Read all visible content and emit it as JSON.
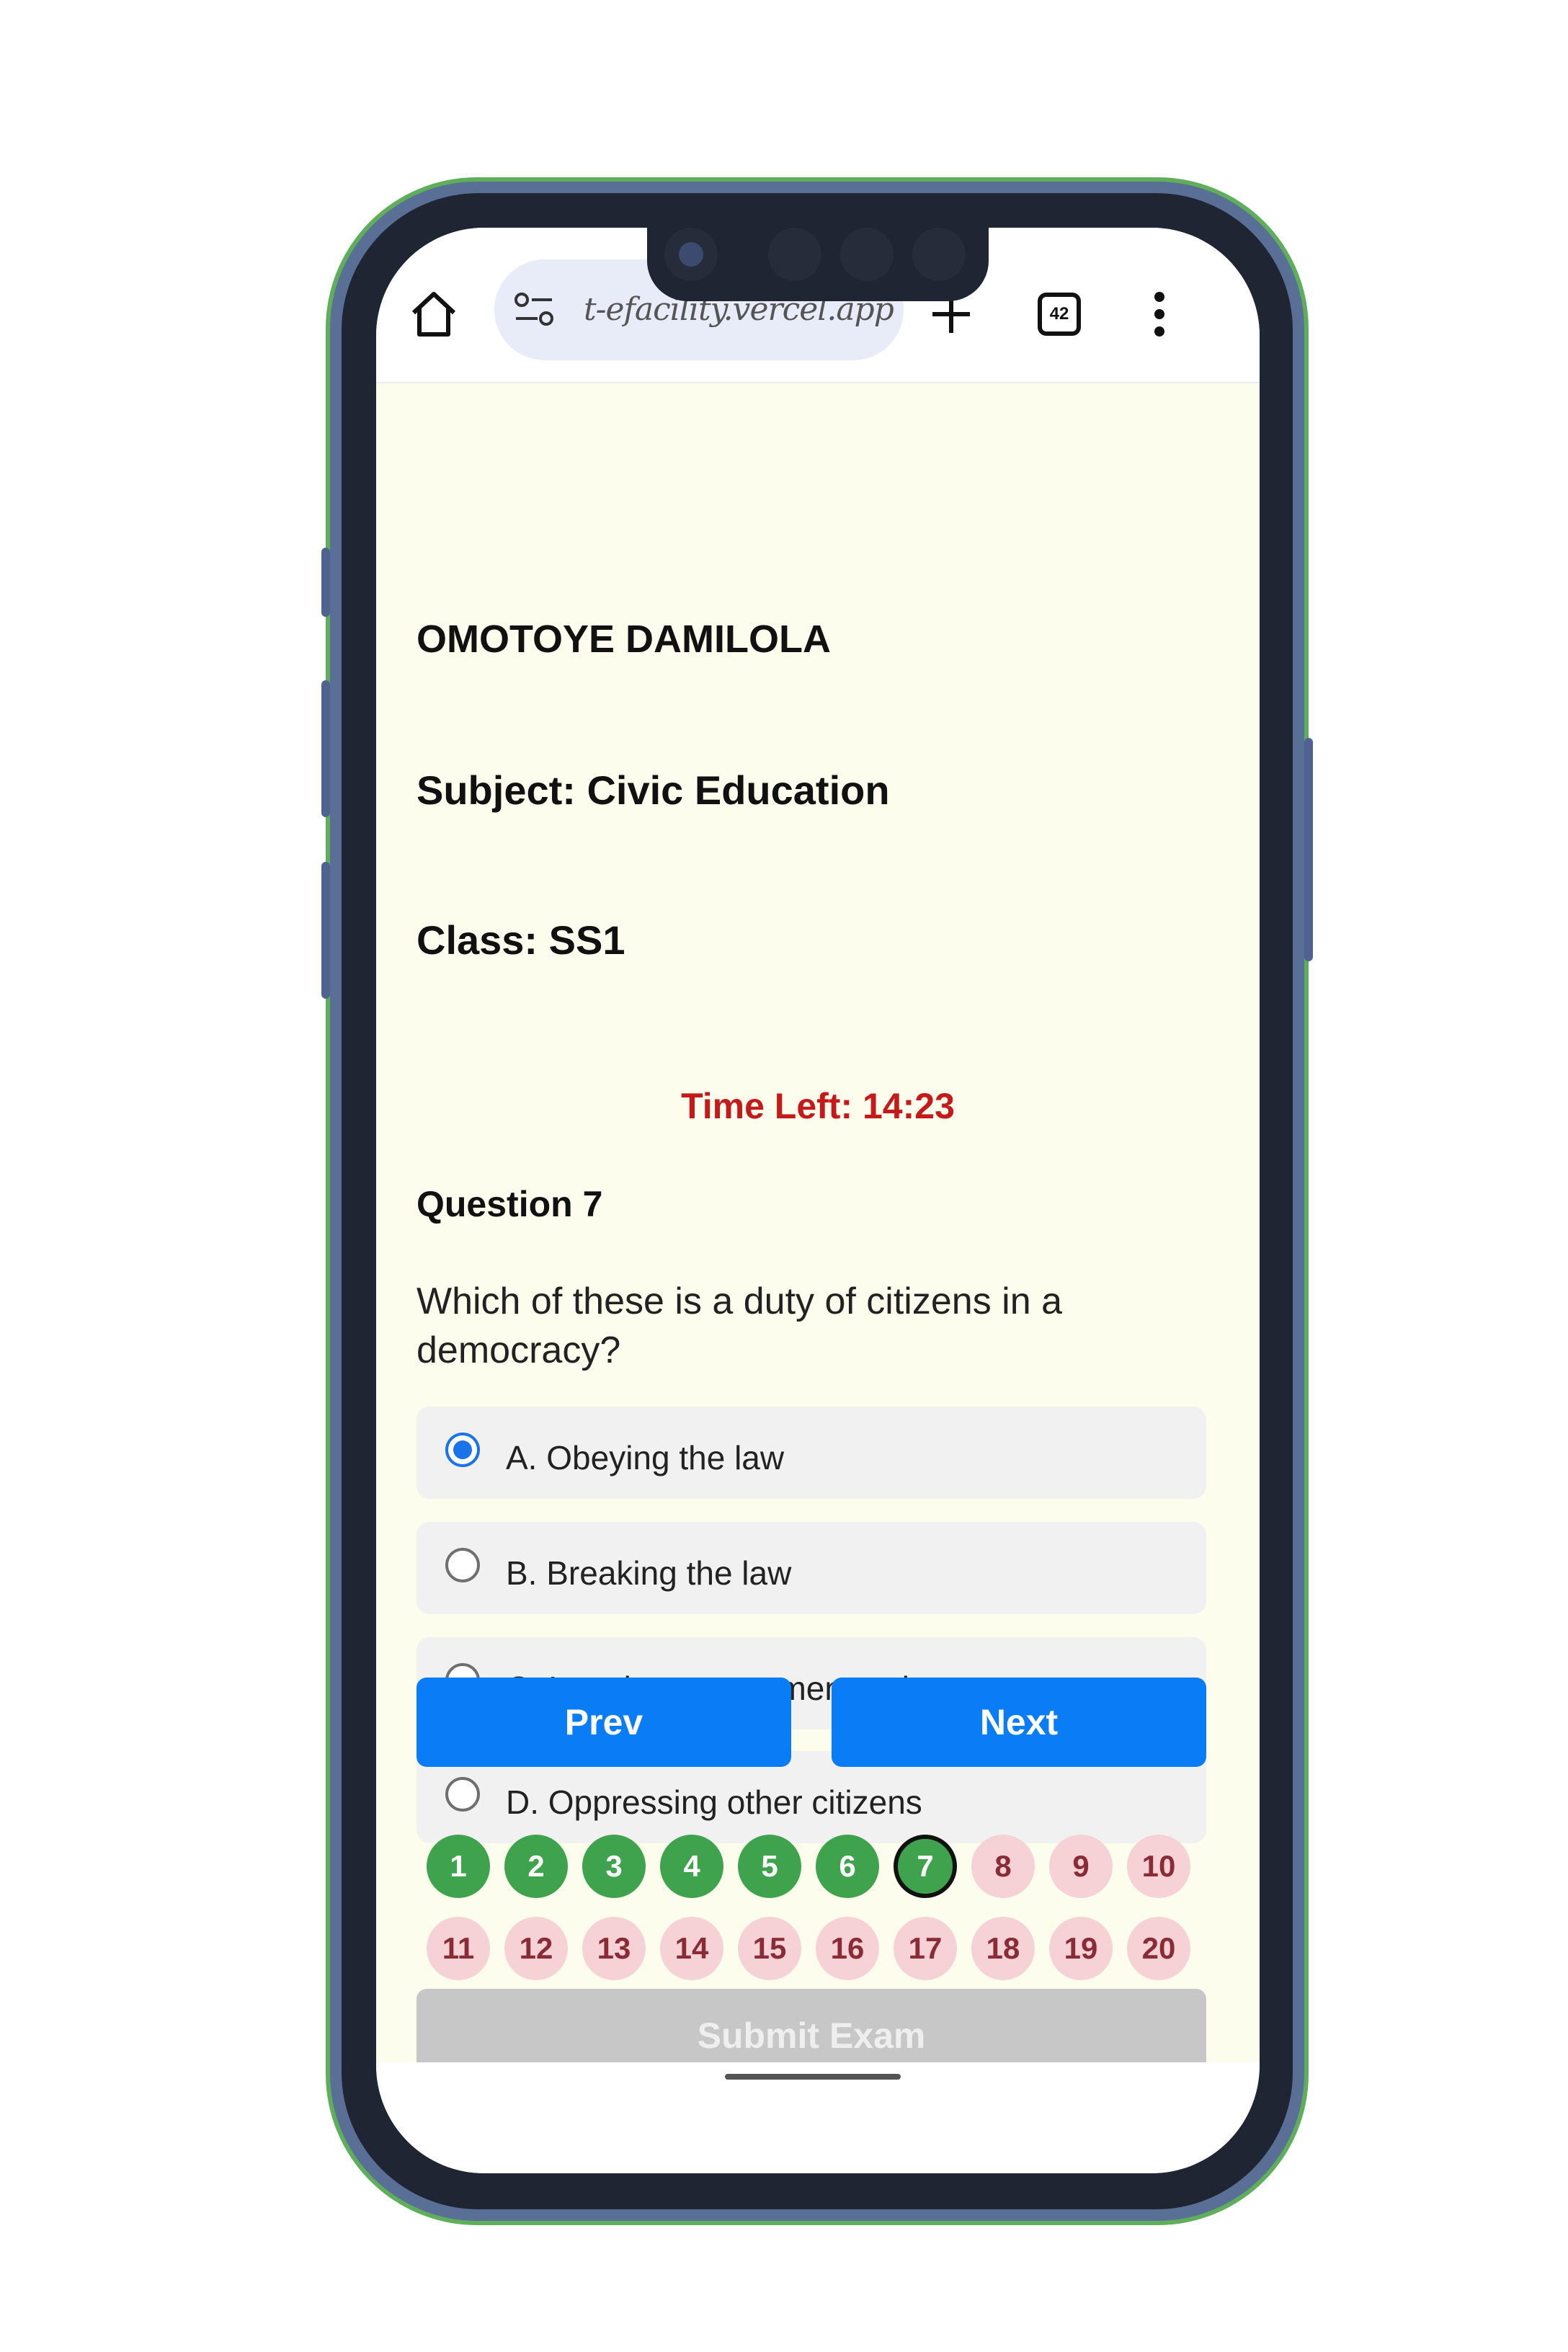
{
  "browser": {
    "url": "t-efacility.vercel.app",
    "tab_count": "42"
  },
  "student": {
    "name": "OMOTOYE DAMILOLA",
    "subject": "Subject: Civic Education",
    "class": "Class: SS1"
  },
  "timer": {
    "label": "Time Left: 14:23",
    "color": "#c41a1a"
  },
  "question": {
    "number_label": "Question 7",
    "text": "Which of these is a duty of citizens in a democracy?",
    "options": [
      {
        "label": "A. Obeying the law",
        "selected": true
      },
      {
        "label": "B. Breaking the law",
        "selected": false
      },
      {
        "label": "C. Ignoring government orders",
        "selected": false
      },
      {
        "label": "D. Oppressing other citizens",
        "selected": false
      }
    ]
  },
  "navigation": {
    "prev_label": "Prev",
    "next_label": "Next"
  },
  "palette": {
    "answered": [
      "1",
      "2",
      "3",
      "4",
      "5",
      "6"
    ],
    "current": "7",
    "unanswered": [
      "8",
      "9",
      "10",
      "11",
      "12",
      "13",
      "14",
      "15",
      "16",
      "17",
      "18",
      "19",
      "20"
    ],
    "colors": {
      "answered": "#3fa34d",
      "unanswered": "#f6d2d6",
      "primary": "#0a7cf6"
    }
  },
  "submit_label": "Submit Exam",
  "icons": [
    "home-icon",
    "site-settings-icon",
    "new-tab-icon",
    "tab-switcher-icon",
    "more-options-icon"
  ]
}
